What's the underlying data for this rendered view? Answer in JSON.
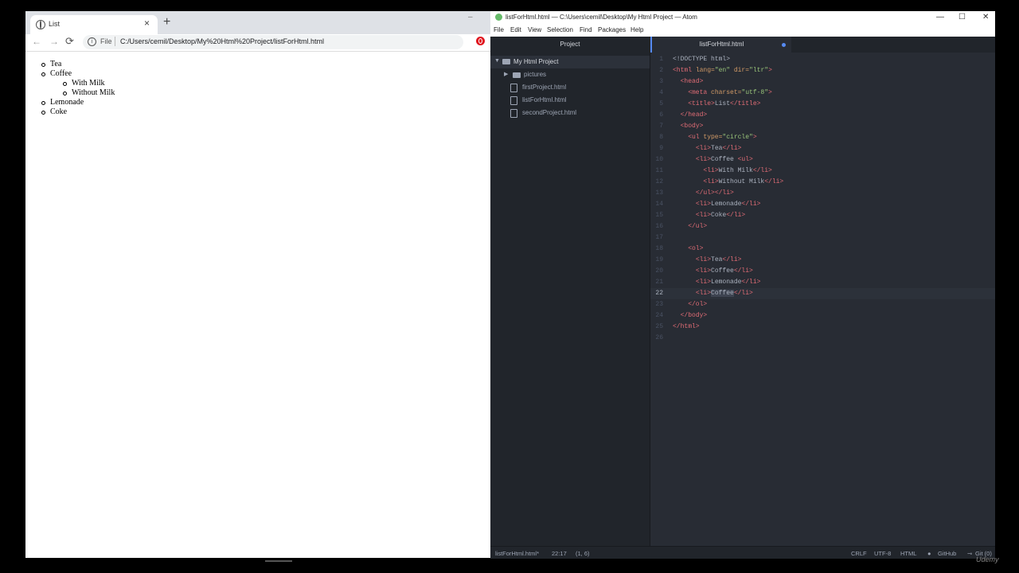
{
  "browser": {
    "tab_title": "List",
    "new_tab": "+",
    "tab_close": "×",
    "window_min": "–",
    "nav": {
      "back": "←",
      "forward": "→",
      "reload": "⟳"
    },
    "omnibox": {
      "info": "i",
      "scheme_label": "File",
      "url": "C:/Users/cemil/Desktop/My%20Html%20Project/listForHtml.html"
    },
    "star": "☆",
    "page": {
      "list": [
        {
          "label": "Tea"
        },
        {
          "label": "Coffee",
          "children": [
            "With Milk",
            "Without Milk"
          ]
        },
        {
          "label": "Lemonade"
        },
        {
          "label": "Coke"
        }
      ]
    }
  },
  "atom": {
    "window_title": "listForHtml.html — C:\\Users\\cemil\\Desktop\\My Html Project — Atom",
    "controls": {
      "minimize": "—",
      "maximize": "☐",
      "close": "✕"
    },
    "menu": [
      "File",
      "Edit",
      "View",
      "Selection",
      "Find",
      "Packages",
      "Help"
    ],
    "project_tab": "Project",
    "editor_tab": "listForHtml.html",
    "tree": {
      "root": "My Html Project",
      "folder": "pictures",
      "files": [
        "firstProject.html",
        "listForHtml.html",
        "secondProject.html"
      ]
    },
    "code_lines": [
      [
        [
          "t",
          "<!DOCTYPE html>"
        ]
      ],
      [
        [
          "g",
          "<html "
        ],
        [
          "a",
          "lang="
        ],
        [
          "s",
          "\"en\""
        ],
        [
          "a",
          " dir="
        ],
        [
          "s",
          "\"ltr\""
        ],
        [
          "g",
          ">"
        ]
      ],
      [
        [
          "t",
          "  "
        ],
        [
          "g",
          "<head>"
        ]
      ],
      [
        [
          "t",
          "    "
        ],
        [
          "g",
          "<meta "
        ],
        [
          "a",
          "charset="
        ],
        [
          "s",
          "\"utf-8\""
        ],
        [
          "g",
          ">"
        ]
      ],
      [
        [
          "t",
          "    "
        ],
        [
          "g",
          "<title>"
        ],
        [
          "t",
          "List"
        ],
        [
          "g",
          "</title>"
        ]
      ],
      [
        [
          "t",
          "  "
        ],
        [
          "g",
          "</head>"
        ]
      ],
      [
        [
          "t",
          "  "
        ],
        [
          "g",
          "<body>"
        ]
      ],
      [
        [
          "t",
          "    "
        ],
        [
          "g",
          "<ul "
        ],
        [
          "a",
          "type="
        ],
        [
          "s",
          "\"circle\""
        ],
        [
          "g",
          ">"
        ]
      ],
      [
        [
          "t",
          "      "
        ],
        [
          "g",
          "<li>"
        ],
        [
          "t",
          "Tea"
        ],
        [
          "g",
          "</li>"
        ]
      ],
      [
        [
          "t",
          "      "
        ],
        [
          "g",
          "<li>"
        ],
        [
          "t",
          "Coffee "
        ],
        [
          "g",
          "<ul>"
        ]
      ],
      [
        [
          "t",
          "        "
        ],
        [
          "g",
          "<li>"
        ],
        [
          "t",
          "With Milk"
        ],
        [
          "g",
          "</li>"
        ]
      ],
      [
        [
          "t",
          "        "
        ],
        [
          "g",
          "<li>"
        ],
        [
          "t",
          "Without Milk"
        ],
        [
          "g",
          "</li>"
        ]
      ],
      [
        [
          "t",
          "      "
        ],
        [
          "g",
          "</ul></li>"
        ]
      ],
      [
        [
          "t",
          "      "
        ],
        [
          "g",
          "<li>"
        ],
        [
          "t",
          "Lemonade"
        ],
        [
          "g",
          "</li>"
        ]
      ],
      [
        [
          "t",
          "      "
        ],
        [
          "g",
          "<li>"
        ],
        [
          "t",
          "Coke"
        ],
        [
          "g",
          "</li>"
        ]
      ],
      [
        [
          "t",
          "    "
        ],
        [
          "g",
          "</ul>"
        ]
      ],
      [
        [
          "t",
          ""
        ]
      ],
      [
        [
          "t",
          "    "
        ],
        [
          "g",
          "<ol>"
        ]
      ],
      [
        [
          "t",
          "      "
        ],
        [
          "g",
          "<li>"
        ],
        [
          "t",
          "Tea"
        ],
        [
          "g",
          "</li>"
        ]
      ],
      [
        [
          "t",
          "      "
        ],
        [
          "g",
          "<li>"
        ],
        [
          "t",
          "Coffee"
        ],
        [
          "g",
          "</li>"
        ]
      ],
      [
        [
          "t",
          "      "
        ],
        [
          "g",
          "<li>"
        ],
        [
          "t",
          "Lemonade"
        ],
        [
          "g",
          "</li>"
        ]
      ],
      [
        [
          "t",
          "      "
        ],
        [
          "g",
          "<li>"
        ],
        [
          "h",
          "Coffee"
        ],
        [
          "g",
          "</li>"
        ]
      ],
      [
        [
          "t",
          "    "
        ],
        [
          "g",
          "</ol>"
        ]
      ],
      [
        [
          "t",
          "  "
        ],
        [
          "g",
          "</body>"
        ]
      ],
      [
        [
          "g",
          "</html>"
        ]
      ],
      [
        [
          "t",
          ""
        ]
      ]
    ],
    "cursor_line": 22,
    "status": {
      "file": "listForHtml.html*",
      "position": "22:17",
      "selection": "(1, 6)",
      "line_ending": "CRLF",
      "encoding": "UTF-8",
      "grammar": "HTML",
      "github": "GitHub",
      "git": "Git (0)"
    }
  },
  "watermark": "Udemy"
}
